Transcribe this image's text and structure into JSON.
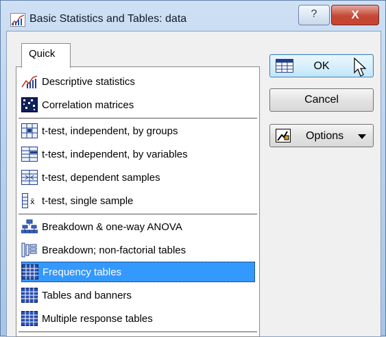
{
  "window": {
    "title": "Basic Statistics and Tables: data",
    "help_label": "?",
    "close_label": "X"
  },
  "tabs": [
    {
      "label": "Quick"
    }
  ],
  "list": {
    "items": [
      {
        "label": "Descriptive statistics",
        "icon": "descriptive-stats-icon"
      },
      {
        "label": "Correlation matrices",
        "icon": "correlation-matrix-icon"
      },
      {
        "label": "t-test, independent, by groups",
        "icon": "ttest-groups-icon"
      },
      {
        "label": "t-test, independent, by variables",
        "icon": "ttest-variables-icon"
      },
      {
        "label": "t-test, dependent samples",
        "icon": "ttest-dependent-icon"
      },
      {
        "label": "t-test, single sample",
        "icon": "ttest-single-icon"
      },
      {
        "label": "Breakdown & one-way ANOVA",
        "icon": "breakdown-anova-icon"
      },
      {
        "label": "Breakdown; non-factorial tables",
        "icon": "breakdown-tables-icon"
      },
      {
        "label": "Frequency tables",
        "icon": "frequency-table-icon"
      },
      {
        "label": "Tables and banners",
        "icon": "tables-banners-icon"
      },
      {
        "label": "Multiple response tables",
        "icon": "multiple-response-icon"
      }
    ],
    "selected": "Frequency tables"
  },
  "buttons": {
    "ok": "OK",
    "cancel": "Cancel",
    "options": "Options"
  },
  "colors": {
    "selection": "#3399ff",
    "close": "#c8442f"
  }
}
